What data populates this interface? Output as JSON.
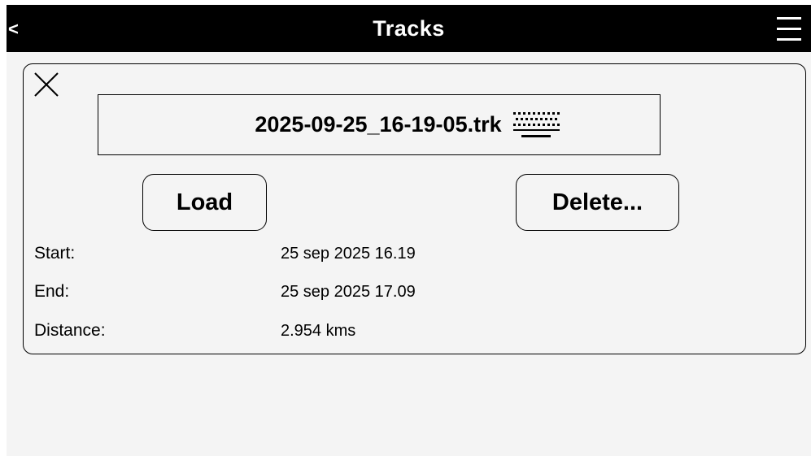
{
  "header": {
    "title": "Tracks",
    "back_label": "<"
  },
  "panel": {
    "file_name": "2025-09-25_16-19-05.trk",
    "load_label": "Load",
    "delete_label": "Delete...",
    "details": [
      {
        "label": "Start:",
        "value": "25 sep 2025 16.19"
      },
      {
        "label": "End:",
        "value": "25 sep 2025 17.09"
      },
      {
        "label": "Distance:",
        "value": "2.954 kms"
      }
    ]
  },
  "icons": {
    "back": "back-arrow-icon",
    "menu": "hamburger-menu-icon",
    "close": "close-icon",
    "keyboard": "keyboard-icon"
  }
}
